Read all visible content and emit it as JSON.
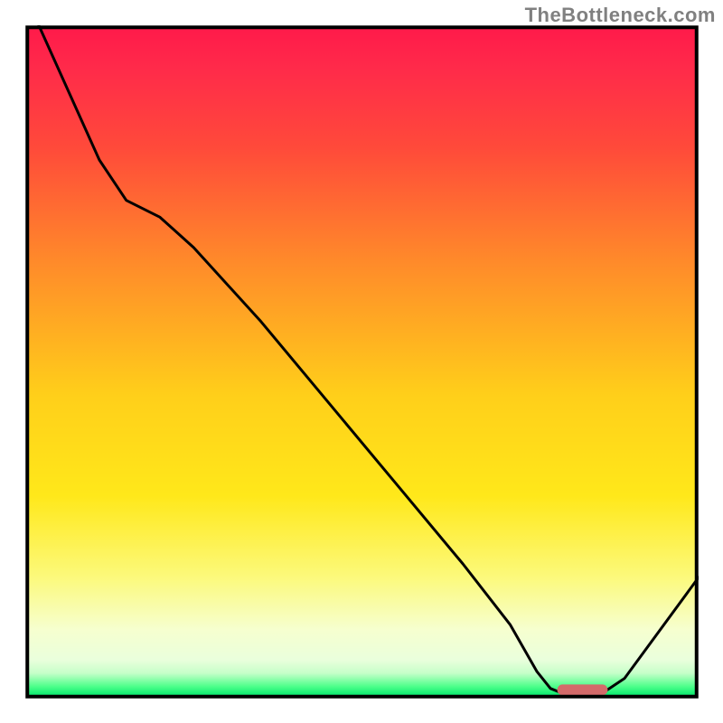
{
  "watermark": "TheBottleneck.com",
  "chart_data": {
    "type": "line",
    "title": "",
    "xlabel": "",
    "ylabel": "",
    "xlim": [
      0,
      100
    ],
    "ylim": [
      0,
      100
    ],
    "gradient_stops": [
      {
        "offset": 0.0,
        "color": "#ff1a4a"
      },
      {
        "offset": 0.06,
        "color": "#ff2a4a"
      },
      {
        "offset": 0.18,
        "color": "#ff4a3a"
      },
      {
        "offset": 0.35,
        "color": "#ff8a2a"
      },
      {
        "offset": 0.55,
        "color": "#ffcf1a"
      },
      {
        "offset": 0.7,
        "color": "#ffe81a"
      },
      {
        "offset": 0.82,
        "color": "#fcf97a"
      },
      {
        "offset": 0.9,
        "color": "#f6ffcf"
      },
      {
        "offset": 0.945,
        "color": "#eaffdc"
      },
      {
        "offset": 0.965,
        "color": "#c6ffc9"
      },
      {
        "offset": 0.985,
        "color": "#4cff8a"
      },
      {
        "offset": 1.0,
        "color": "#00e66a"
      }
    ],
    "series": [
      {
        "name": "bottleneck-curve",
        "points": [
          {
            "x": 2.0,
            "y": 100.0
          },
          {
            "x": 6.5,
            "y": 90.0
          },
          {
            "x": 11.0,
            "y": 80.0
          },
          {
            "x": 15.0,
            "y": 74.0
          },
          {
            "x": 20.0,
            "y": 71.5
          },
          {
            "x": 25.0,
            "y": 67.0
          },
          {
            "x": 35.0,
            "y": 56.0
          },
          {
            "x": 45.0,
            "y": 44.0
          },
          {
            "x": 55.0,
            "y": 32.0
          },
          {
            "x": 65.0,
            "y": 20.0
          },
          {
            "x": 72.0,
            "y": 11.0
          },
          {
            "x": 76.0,
            "y": 4.0
          },
          {
            "x": 78.0,
            "y": 1.5
          },
          {
            "x": 80.0,
            "y": 0.7
          },
          {
            "x": 83.0,
            "y": 0.5
          },
          {
            "x": 86.0,
            "y": 1.0
          },
          {
            "x": 89.0,
            "y": 3.0
          },
          {
            "x": 100.0,
            "y": 18.0
          }
        ]
      }
    ],
    "marker": {
      "name": "optimal-range",
      "shape": "rounded-bar",
      "x_start": 79.0,
      "x_end": 86.5,
      "y": 0.5,
      "height": 1.6,
      "color": "#d46a6a"
    }
  }
}
